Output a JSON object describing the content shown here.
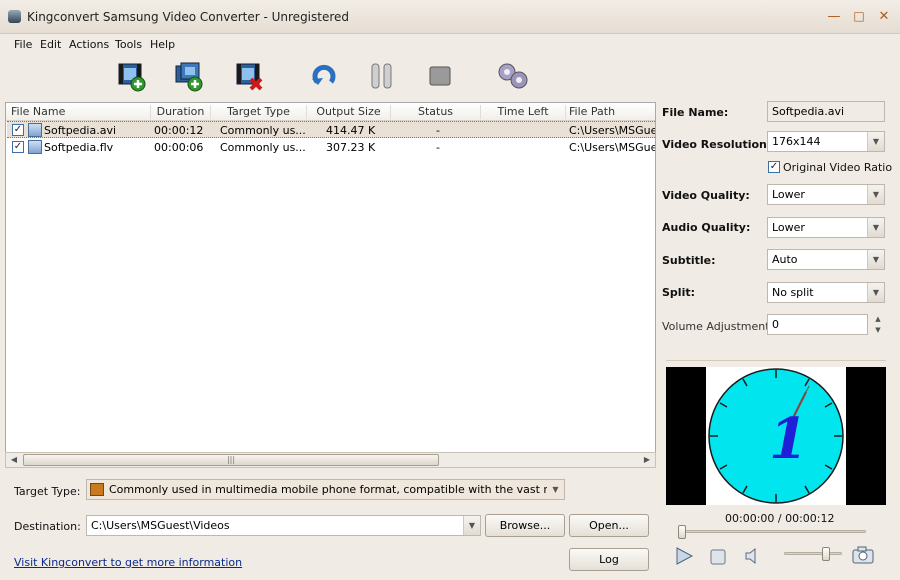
{
  "window": {
    "title": "Kingconvert Samsung Video Converter - Unregistered",
    "controls": [
      "minimize-icon",
      "maximize-icon",
      "close-icon"
    ]
  },
  "menu": [
    "File",
    "Edit",
    "Actions",
    "Tools",
    "Help"
  ],
  "toolbar": [
    "add-video-icon",
    "add-folder-icon",
    "remove-icon",
    "convert-icon",
    "pause-icon",
    "stop-icon",
    "settings-icon"
  ],
  "list": {
    "columns": [
      "File Name",
      "Duration",
      "Target Type",
      "Output Size",
      "Status",
      "Time Left",
      "File Path"
    ],
    "rows": [
      {
        "checked": "✓",
        "name": "Softpedia.avi",
        "duration": "00:00:12",
        "target": "Commonly us...",
        "size": "414.47 K",
        "status": "-",
        "time_left": "",
        "path": "C:\\Users\\MSGuest"
      },
      {
        "checked": "✓",
        "name": "Softpedia.flv",
        "duration": "00:00:06",
        "target": "Commonly us...",
        "size": "307.23 K",
        "status": "-",
        "time_left": "",
        "path": "C:\\Users\\MSGuest"
      }
    ],
    "scroll_grip": "|||"
  },
  "bottom": {
    "target_type_label": "Target Type:",
    "target_type_value": "Commonly used in multimedia mobile phone format, compatible with the vast majority of mobile p",
    "destination_label": "Destination:",
    "destination_value": "C:\\Users\\MSGuest\\Videos",
    "browse": "Browse...",
    "open": "Open...",
    "visit_link": "Visit Kingconvert to get more information",
    "log": "Log"
  },
  "settings": {
    "file_name_label": "File Name:",
    "file_name_value": "Softpedia.avi",
    "resolution_label": "Video Resolution:",
    "resolution_value": "176x144",
    "original_ratio_label": "Original Video Ratio",
    "original_ratio_check": "✓",
    "video_quality_label": "Video Quality:",
    "video_quality_value": "Lower",
    "audio_quality_label": "Audio Quality:",
    "audio_quality_value": "Lower",
    "subtitle_label": "Subtitle:",
    "subtitle_value": "Auto",
    "split_label": "Split:",
    "split_value": "No split",
    "volume_label": "Volume Adjustment:",
    "volume_value": "0"
  },
  "player": {
    "time": "00:00:00 / 00:00:12",
    "frame_digit": "1",
    "progress": 0,
    "volume": 0.75
  },
  "colors": {
    "accent": "#b0581c",
    "clock_face": "#00e5ee",
    "link": "#0a2a8a"
  }
}
